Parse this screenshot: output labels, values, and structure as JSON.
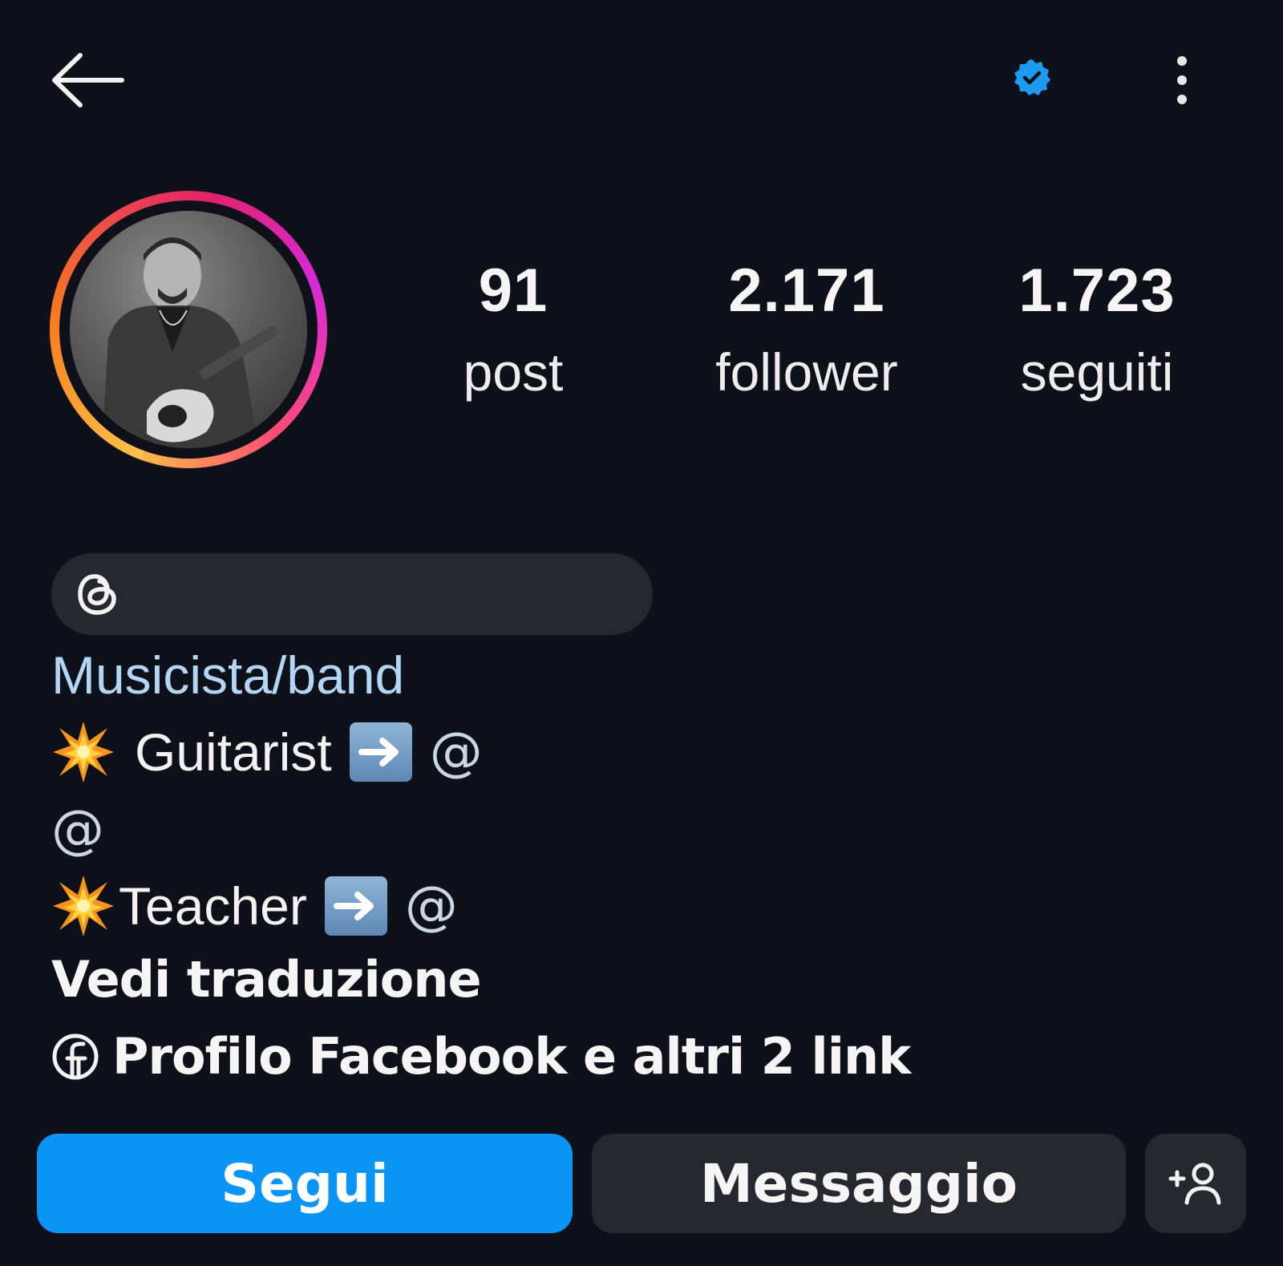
{
  "header": {
    "back_icon": "arrow-left-icon",
    "verified_icon": "verified-badge-icon",
    "verified_color": "#1d9bf0",
    "more_icon": "more-vertical-icon"
  },
  "stats": [
    {
      "value": "91",
      "label": "post"
    },
    {
      "value": "2.171",
      "label": "follower"
    },
    {
      "value": "1.723",
      "label": "seguiti"
    }
  ],
  "threads": {
    "icon": "threads-icon"
  },
  "bio": {
    "category": "Musicista/band",
    "line1": {
      "emoji": "💥",
      "text": "Guitarist",
      "arrow": "➡️",
      "mention": "@"
    },
    "line2": {
      "mention": "@"
    },
    "line3": {
      "emoji": "💥",
      "text": "Teacher",
      "arrow": "➡️",
      "mention": "@"
    },
    "translate": "Vedi traduzione",
    "links": {
      "icon": "facebook-icon",
      "text": "Profilo Facebook e altri 2 link"
    }
  },
  "actions": {
    "follow_label": "Segui",
    "message_label": "Messaggio",
    "add_user_icon": "add-user-icon",
    "follow_color": "#0a95f6"
  }
}
